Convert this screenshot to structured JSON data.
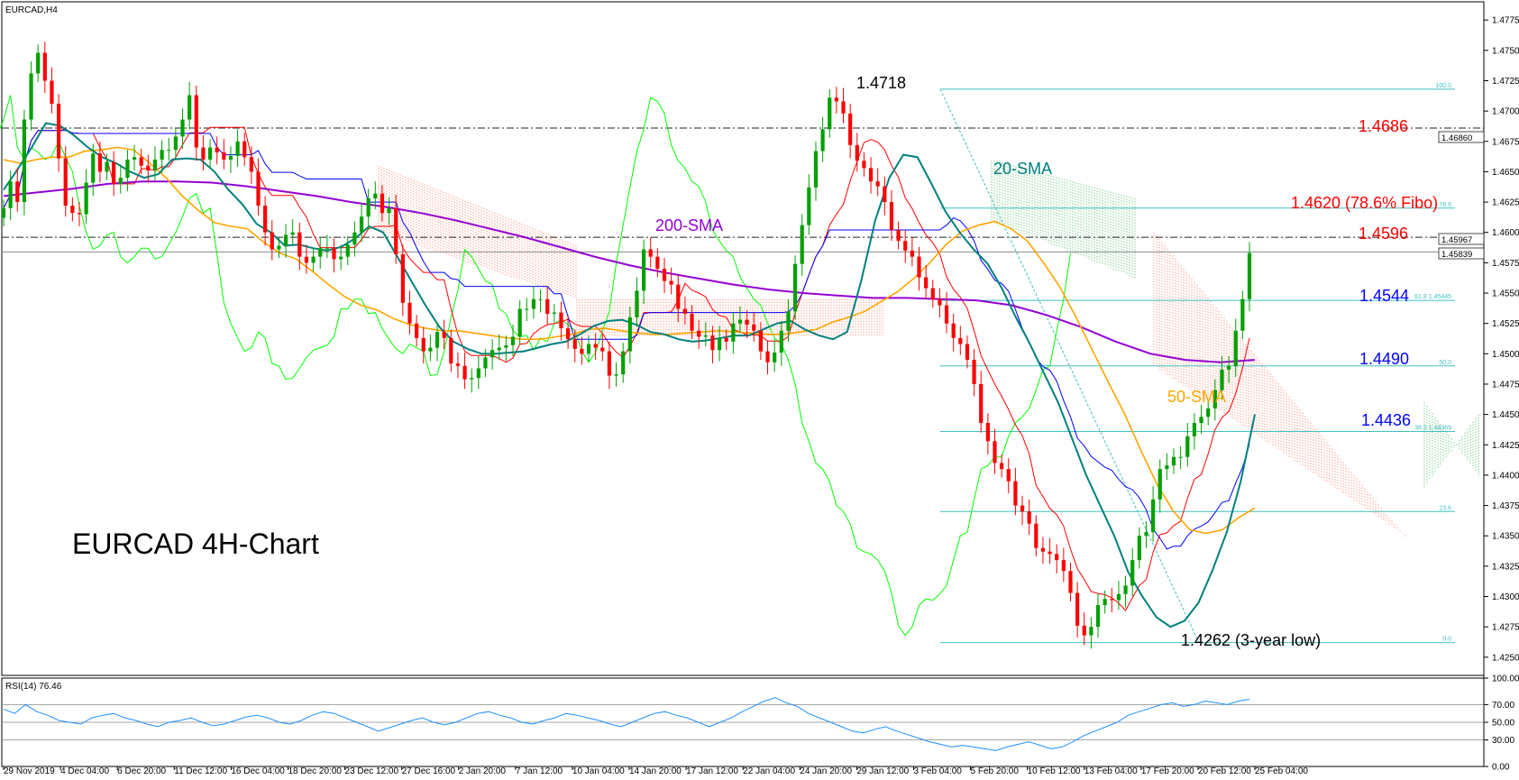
{
  "chart_data": [
    {
      "type": "candlestick",
      "symbol_label": "EURCAD,H4",
      "title": "EURCAD 4H-Chart",
      "ylim": [
        1.4235,
        1.479
      ],
      "yticks": [
        "1.47750",
        "1.47500",
        "1.47250",
        "1.47000",
        "1.46750",
        "1.46500",
        "1.46250",
        "1.46000",
        "1.45750",
        "1.45500",
        "1.45250",
        "1.45000",
        "1.44750",
        "1.44500",
        "1.44250",
        "1.44000",
        "1.43750",
        "1.43500",
        "1.43250",
        "1.43000",
        "1.42750",
        "1.42500"
      ],
      "xticks": [
        "29 Nov 2019",
        "4 Dec 04:00",
        "6 Dec 20:00",
        "11 Dec 12:00",
        "16 Dec 04:00",
        "18 Dec 20:00",
        "23 Dec 12:00",
        "27 Dec 16:00",
        "2 Jan 20:00",
        "7 Jan 12:00",
        "10 Jan 04:00",
        "14 Jan 20:00",
        "17 Jan 12:00",
        "22 Jan 04:00",
        "24 Jan 20:00",
        "29 Jan 12:00",
        "3 Feb 04:00",
        "5 Feb 20:00",
        "10 Feb 12:00",
        "13 Feb 04:00",
        "17 Feb 20:00",
        "20 Feb 12:00",
        "25 Feb 04:00"
      ],
      "price_labels": [
        "1.46860",
        "1.45967",
        "1.45839"
      ],
      "horizontal_levels": [
        {
          "label": "1.4686",
          "value": 1.4686,
          "style": "dashdot",
          "color": "#222222",
          "text_color": "#ff0000"
        },
        {
          "label": "1.4596",
          "value": 1.4596,
          "style": "dashdot",
          "color": "#222222",
          "text_color": "#ff0000"
        },
        {
          "label": "",
          "value": 1.45839,
          "style": "solid",
          "color": "#888888",
          "text_color": ""
        }
      ],
      "fibonacci": {
        "high": 1.4718,
        "low": 1.4262,
        "levels": [
          {
            "ratio": "100.0",
            "value": 1.4718,
            "annotation": ""
          },
          {
            "ratio": "78.6",
            "value": 1.462,
            "annotation": "1.4620 (78.6% Fibo)",
            "annotation_color": "#ff0000"
          },
          {
            "ratio": "61.8",
            "value": 1.4544,
            "annotation": "1.4544",
            "annotation_color": "#0000ff",
            "small": "61.8 1.45445"
          },
          {
            "ratio": "50.0",
            "value": 1.449,
            "annotation": "1.4490",
            "annotation_color": "#0000ff"
          },
          {
            "ratio": "38.2",
            "value": 1.4436,
            "annotation": "1.4436",
            "annotation_color": "#0000ff",
            "small": "38.2 1.44369"
          },
          {
            "ratio": "23.6",
            "value": 1.437,
            "annotation": ""
          },
          {
            "ratio": "0.0",
            "value": 1.4262,
            "annotation": ""
          }
        ]
      },
      "annotations": {
        "high_label": "1.4718",
        "low_label": "1.4262 (3-year low)",
        "sma20_label": "20-SMA",
        "sma50_label": "50-SMA",
        "sma200_label": "200-SMA"
      },
      "colors": {
        "bull": "#00a000",
        "bear": "#ff0000",
        "sma20": "#008080",
        "sma50": "#ffa500",
        "sma200": "#9400d3",
        "tenkan": "#ff0000",
        "kijun": "#0000ff",
        "chikou": "#00ff00",
        "fibo": "#40c0c0",
        "sma200_text": "#9400d3",
        "sma50_text": "#ffa500",
        "sma20_text": "#008080"
      },
      "series": [
        {
          "name": "close",
          "values": [
            1.462,
            1.4642,
            1.4625,
            1.4693,
            1.4731,
            1.4748,
            1.4725,
            1.4706,
            1.4661,
            1.4622,
            1.4616,
            1.4615,
            1.4641,
            1.4665,
            1.465,
            1.4658,
            1.464,
            1.4645,
            1.466,
            1.4662,
            1.4655,
            1.4651,
            1.466,
            1.4668,
            1.4668,
            1.4679,
            1.4693,
            1.4713,
            1.467,
            1.466,
            1.467,
            1.4666,
            1.466,
            1.4663,
            1.4675,
            1.4662,
            1.465,
            1.4622,
            1.46,
            1.4586,
            1.4589,
            1.4598,
            1.46,
            1.458,
            1.4575,
            1.458,
            1.4587,
            1.4587,
            1.4578,
            1.458,
            1.459,
            1.46,
            1.4613,
            1.4628,
            1.4632,
            1.4616,
            1.462,
            1.4582,
            1.4542,
            1.4525,
            1.4513,
            1.4502,
            1.4505,
            1.4518,
            1.4513,
            1.4492,
            1.449,
            1.4479,
            1.448,
            1.4488,
            1.4497,
            1.4503,
            1.4505,
            1.4507,
            1.4514,
            1.4537,
            1.4537,
            1.4545,
            1.4545,
            1.4533,
            1.4534,
            1.4521,
            1.4512,
            1.4504,
            1.45,
            1.4508,
            1.4505,
            1.4502,
            1.4482,
            1.4483,
            1.4502,
            1.453,
            1.4552,
            1.4586,
            1.458,
            1.457,
            1.456,
            1.4557,
            1.4537,
            1.4533,
            1.4519,
            1.4514,
            1.4515,
            1.4503,
            1.4513,
            1.451,
            1.4525,
            1.4528,
            1.4524,
            1.4519,
            1.4502,
            1.4493,
            1.4501,
            1.4519,
            1.4535,
            1.4574,
            1.4606,
            1.4637,
            1.4667,
            1.4685,
            1.4711,
            1.4708,
            1.4698,
            1.4672,
            1.4659,
            1.4653,
            1.4642,
            1.4638,
            1.4625,
            1.4602,
            1.4593,
            1.4585,
            1.458,
            1.4563,
            1.4554,
            1.4545,
            1.454,
            1.4525,
            1.4513,
            1.4508,
            1.4495,
            1.4475,
            1.4443,
            1.4428,
            1.441,
            1.4405,
            1.4395,
            1.4375,
            1.437,
            1.436,
            1.434,
            1.4337,
            1.4335,
            1.433,
            1.4321,
            1.4303,
            1.4276,
            1.4268,
            1.4275,
            1.4293,
            1.4298,
            1.4297,
            1.4302,
            1.4309,
            1.433,
            1.435,
            1.4353,
            1.438,
            1.4405,
            1.4408,
            1.4415,
            1.4415,
            1.4432,
            1.4443,
            1.4448,
            1.4455,
            1.447,
            1.4487,
            1.449,
            1.4519,
            1.4545,
            1.4583
          ]
        },
        {
          "name": "20-SMA",
          "values": [
            1.4635,
            1.4652,
            1.467,
            1.469,
            1.4688,
            1.468,
            1.467,
            1.4662,
            1.4657,
            1.465,
            1.4645,
            1.4648,
            1.466,
            1.4661,
            1.466,
            1.465,
            1.4635,
            1.4623,
            1.4607,
            1.46,
            1.4589,
            1.459,
            1.4587,
            1.4585,
            1.4588,
            1.4595,
            1.4605,
            1.46,
            1.458,
            1.456,
            1.454,
            1.4522,
            1.451,
            1.4504,
            1.45,
            1.45,
            1.4501,
            1.4502,
            1.4505,
            1.4508,
            1.451,
            1.4516,
            1.4523,
            1.4527,
            1.4528,
            1.4524,
            1.4518,
            1.4516,
            1.4512,
            1.451,
            1.4511,
            1.4513,
            1.4515,
            1.4515,
            1.452,
            1.4525,
            1.4527,
            1.452,
            1.4515,
            1.4512,
            1.4518,
            1.456,
            1.461,
            1.4645,
            1.4664,
            1.4662,
            1.464,
            1.4617,
            1.46,
            1.4586,
            1.4574,
            1.4554,
            1.453,
            1.4508,
            1.4484,
            1.446,
            1.443,
            1.44,
            1.4375,
            1.435,
            1.432,
            1.43,
            1.4283,
            1.4275,
            1.428,
            1.4295,
            1.4322,
            1.4353,
            1.4395,
            1.445
          ]
        },
        {
          "name": "50-SMA",
          "values": [
            1.466,
            1.4657,
            1.466,
            1.4662,
            1.4662,
            1.4667,
            1.4668,
            1.467,
            1.4668,
            1.4657,
            1.4645,
            1.463,
            1.4618,
            1.4608,
            1.4605,
            1.4603,
            1.4592,
            1.4583,
            1.4578,
            1.4568,
            1.4557,
            1.4547,
            1.454,
            1.4536,
            1.4529,
            1.4524,
            1.4521,
            1.4519,
            1.4519,
            1.4517,
            1.4515,
            1.4513,
            1.4512,
            1.4512,
            1.4514,
            1.4516,
            1.452,
            1.4521,
            1.4519,
            1.4517,
            1.4516,
            1.4516,
            1.4517,
            1.4518,
            1.4519,
            1.4518,
            1.4517,
            1.4516,
            1.4516,
            1.4518,
            1.452,
            1.4526,
            1.453,
            1.4535,
            1.4543,
            1.4551,
            1.4562,
            1.4575,
            1.459,
            1.4601,
            1.4606,
            1.4609,
            1.4603,
            1.4593,
            1.4575,
            1.4555,
            1.453,
            1.4503,
            1.4476,
            1.445,
            1.442,
            1.4392,
            1.437,
            1.4355,
            1.4352,
            1.4355,
            1.4365,
            1.4373
          ]
        },
        {
          "name": "200-SMA",
          "values": [
            1.463,
            1.4633,
            1.4636,
            1.464,
            1.4642,
            1.4642,
            1.4641,
            1.4638,
            1.4634,
            1.463,
            1.4625,
            1.4621,
            1.4616,
            1.461,
            1.4603,
            1.4596,
            1.4588,
            1.458,
            1.4573,
            1.4567,
            1.4562,
            1.4557,
            1.4553,
            1.455,
            1.4548,
            1.4546,
            1.4546,
            1.4545,
            1.4544,
            1.454,
            1.4532,
            1.4522,
            1.451,
            1.45,
            1.4495,
            1.4493,
            1.4495
          ]
        }
      ]
    },
    {
      "type": "line",
      "title": "RSI(14) 76.46",
      "ylim": [
        0,
        100
      ],
      "yticks": [
        "100.00",
        "70.00",
        "50.00",
        "30.00",
        "0.00"
      ],
      "levels": [
        70,
        50,
        30
      ],
      "colors": {
        "line": "#1e90ff",
        "level": "#888888"
      },
      "series": [
        {
          "name": "RSI(14)",
          "values": [
            65,
            60,
            70,
            62,
            58,
            52,
            50,
            48,
            55,
            58,
            60,
            55,
            52,
            48,
            45,
            50,
            52,
            55,
            50,
            46,
            48,
            52,
            56,
            58,
            55,
            50,
            48,
            52,
            58,
            62,
            60,
            55,
            50,
            45,
            40,
            44,
            48,
            52,
            55,
            50,
            47,
            50,
            55,
            60,
            62,
            58,
            55,
            50,
            48,
            52,
            55,
            60,
            58,
            55,
            52,
            48,
            45,
            50,
            55,
            60,
            62,
            58,
            55,
            50,
            45,
            50,
            55,
            62,
            68,
            74,
            78,
            72,
            68,
            60,
            55,
            50,
            45,
            40,
            38,
            42,
            45,
            40,
            36,
            32,
            28,
            25,
            22,
            24,
            22,
            20,
            18,
            22,
            25,
            28,
            24,
            20,
            22,
            28,
            35,
            40,
            45,
            50,
            58,
            62,
            66,
            70,
            72,
            68,
            70,
            74,
            72,
            70,
            74,
            76
          ]
        }
      ]
    }
  ]
}
